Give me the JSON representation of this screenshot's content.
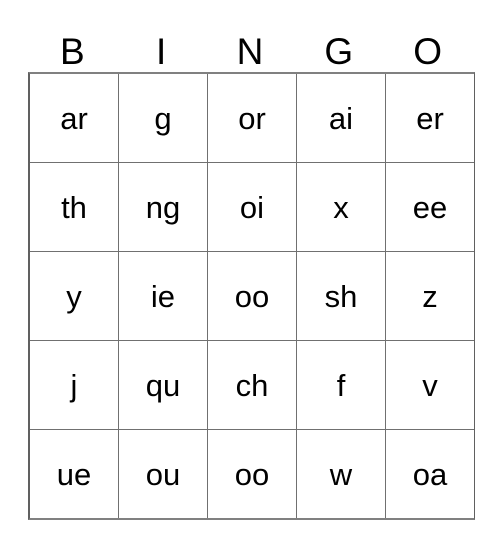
{
  "card": {
    "title": "BINGO",
    "columns": 5,
    "rows": 5,
    "header": [
      "B",
      "I",
      "N",
      "G",
      "O"
    ],
    "grid": [
      [
        "ar",
        "g",
        "or",
        "ai",
        "er"
      ],
      [
        "th",
        "ng",
        "oi",
        "x",
        "ee"
      ],
      [
        "y",
        "ie",
        "oo",
        "sh",
        "z"
      ],
      [
        "j",
        "qu",
        "ch",
        "f",
        "v"
      ],
      [
        "ue",
        "ou",
        "oo",
        "w",
        "oa"
      ]
    ],
    "colors": {
      "background": "#ffffff",
      "text": "#000000",
      "grid_line": "#707070",
      "grid_border": "#808080"
    }
  }
}
